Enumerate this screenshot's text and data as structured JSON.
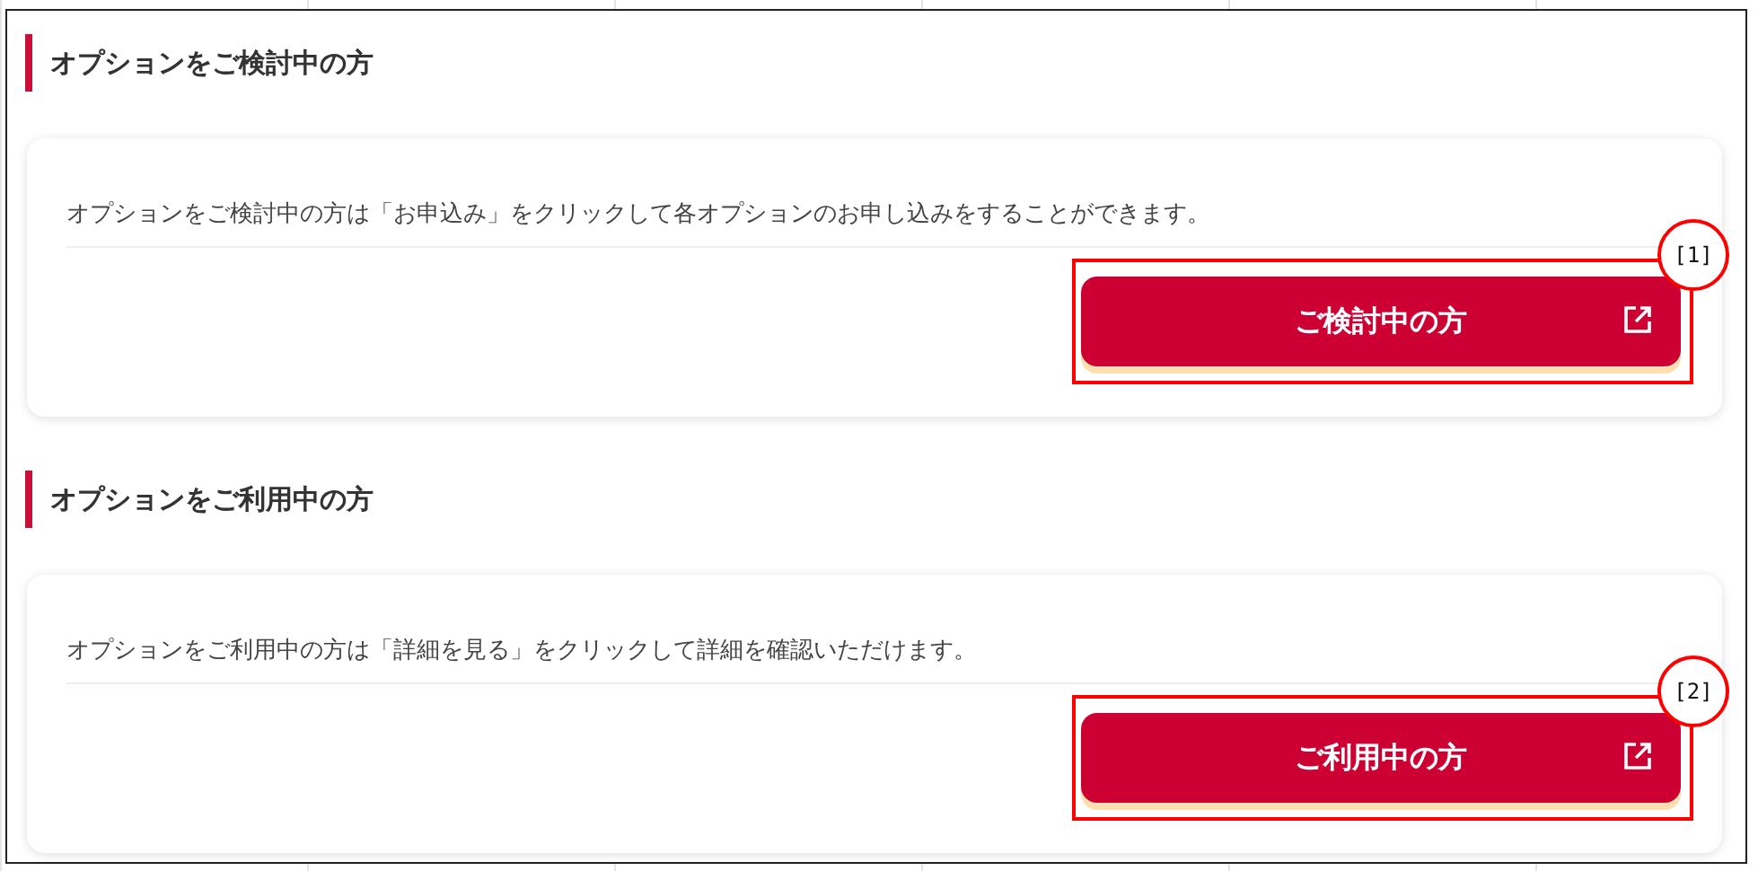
{
  "sections": [
    {
      "heading": "オプションをご検討中の方",
      "description": "オプションをご検討中の方は「お申込み」をクリックして各オプションのお申し込みをすることができます。",
      "button": {
        "label": "ご検討中の方"
      },
      "annotation": "[1]"
    },
    {
      "heading": "オプションをご利用中の方",
      "description": "オプションをご利用中の方は「詳細を見る」をクリックして詳細を確認いただけます。",
      "button": {
        "label": "ご利用中の方"
      },
      "annotation": "[2]"
    }
  ]
}
